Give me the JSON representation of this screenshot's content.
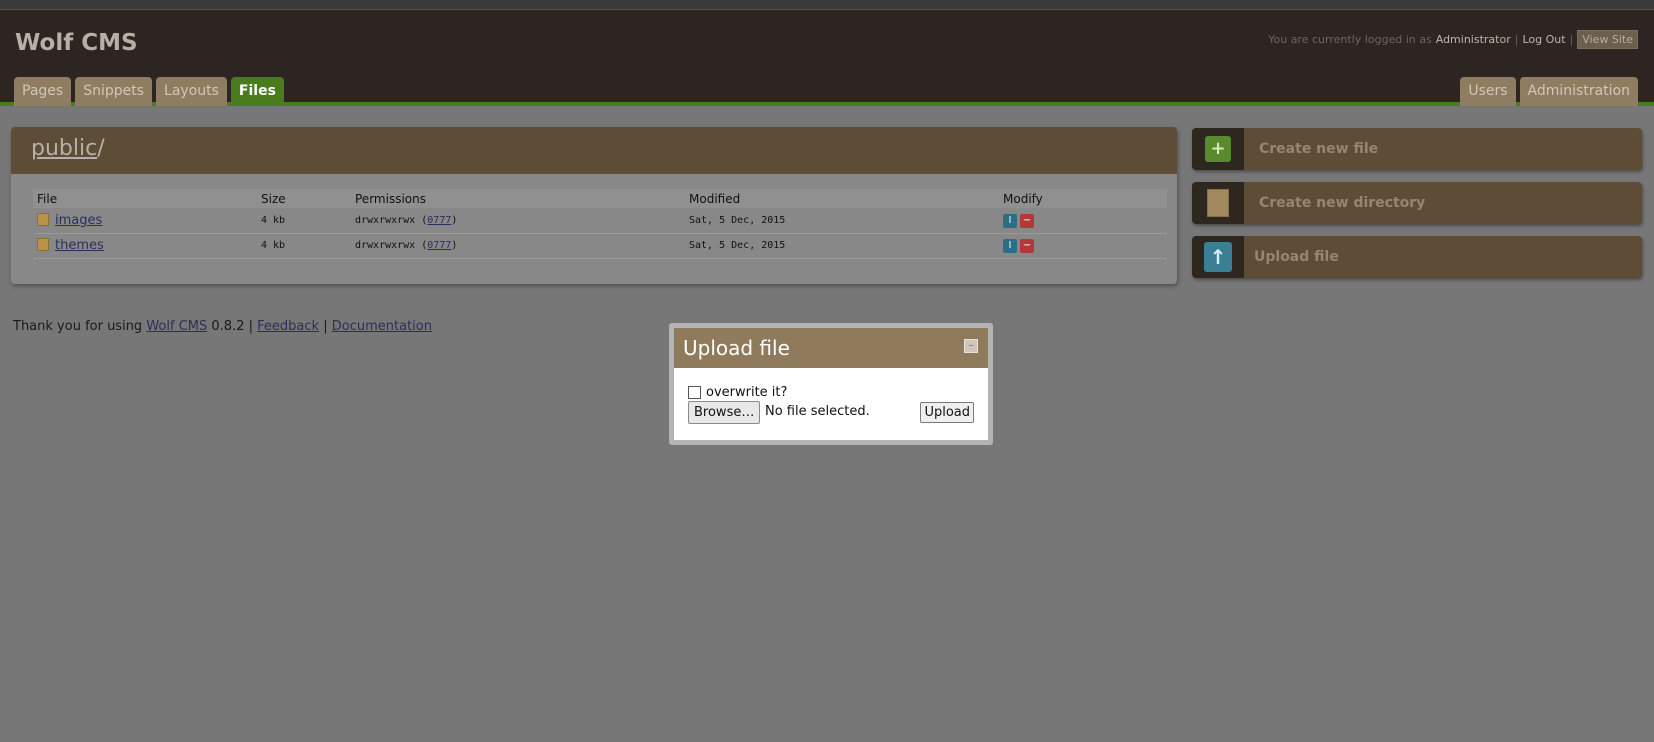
{
  "header": {
    "site_title": "Wolf CMS",
    "logged_in_text": "You are currently logged in as",
    "user_name": "Administrator",
    "separator": "|",
    "logout_label": "Log Out",
    "view_site_label": "View Site"
  },
  "tabs_left": [
    {
      "label": "Pages"
    },
    {
      "label": "Snippets"
    },
    {
      "label": "Layouts"
    },
    {
      "label": "Files",
      "active": true
    }
  ],
  "tabs_right": [
    {
      "label": "Users"
    },
    {
      "label": "Administration"
    }
  ],
  "panel": {
    "breadcrumb_folder": "public",
    "breadcrumb_slash": "/",
    "columns": [
      "File",
      "Size",
      "Permissions",
      "Modified",
      "Modify"
    ],
    "rows": [
      {
        "name": "images",
        "size": "4 kb",
        "permissions": "drwxrwxrwx",
        "perm_open": "(",
        "perm_code": "0777",
        "perm_close": ")",
        "modified": "Sat, 5 Dec, 2015"
      },
      {
        "name": "themes",
        "size": "4 kb",
        "permissions": "drwxrwxrwx",
        "perm_open": "(",
        "perm_code": "0777",
        "perm_close": ")",
        "modified": "Sat, 5 Dec, 2015"
      }
    ],
    "rename_glyph": "I",
    "delete_glyph": "−"
  },
  "sidebar": {
    "create_file_label": "Create new file",
    "create_directory_label": "Create new directory",
    "upload_file_label": "Upload file",
    "plus_glyph": "+",
    "arrow_glyph": "↑"
  },
  "footer": {
    "prefix": "Thank you for using",
    "cms_link": "Wolf CMS",
    "version": "0.8.2",
    "separator": "|",
    "feedback_link": "Feedback",
    "documentation_link": "Documentation"
  },
  "dialog": {
    "title": "Upload file",
    "close_glyph": "–",
    "overwrite_label": "overwrite it?",
    "browse_label": "Browse…",
    "file_status": "No file selected.",
    "upload_label": "Upload"
  },
  "colors": {
    "header_bg": "#2c2521",
    "accent_green": "#4a7b1c",
    "panel_brown": "#5d4d37",
    "dialog_header": "#8f7a5b",
    "overlay_gray": "#777777"
  }
}
